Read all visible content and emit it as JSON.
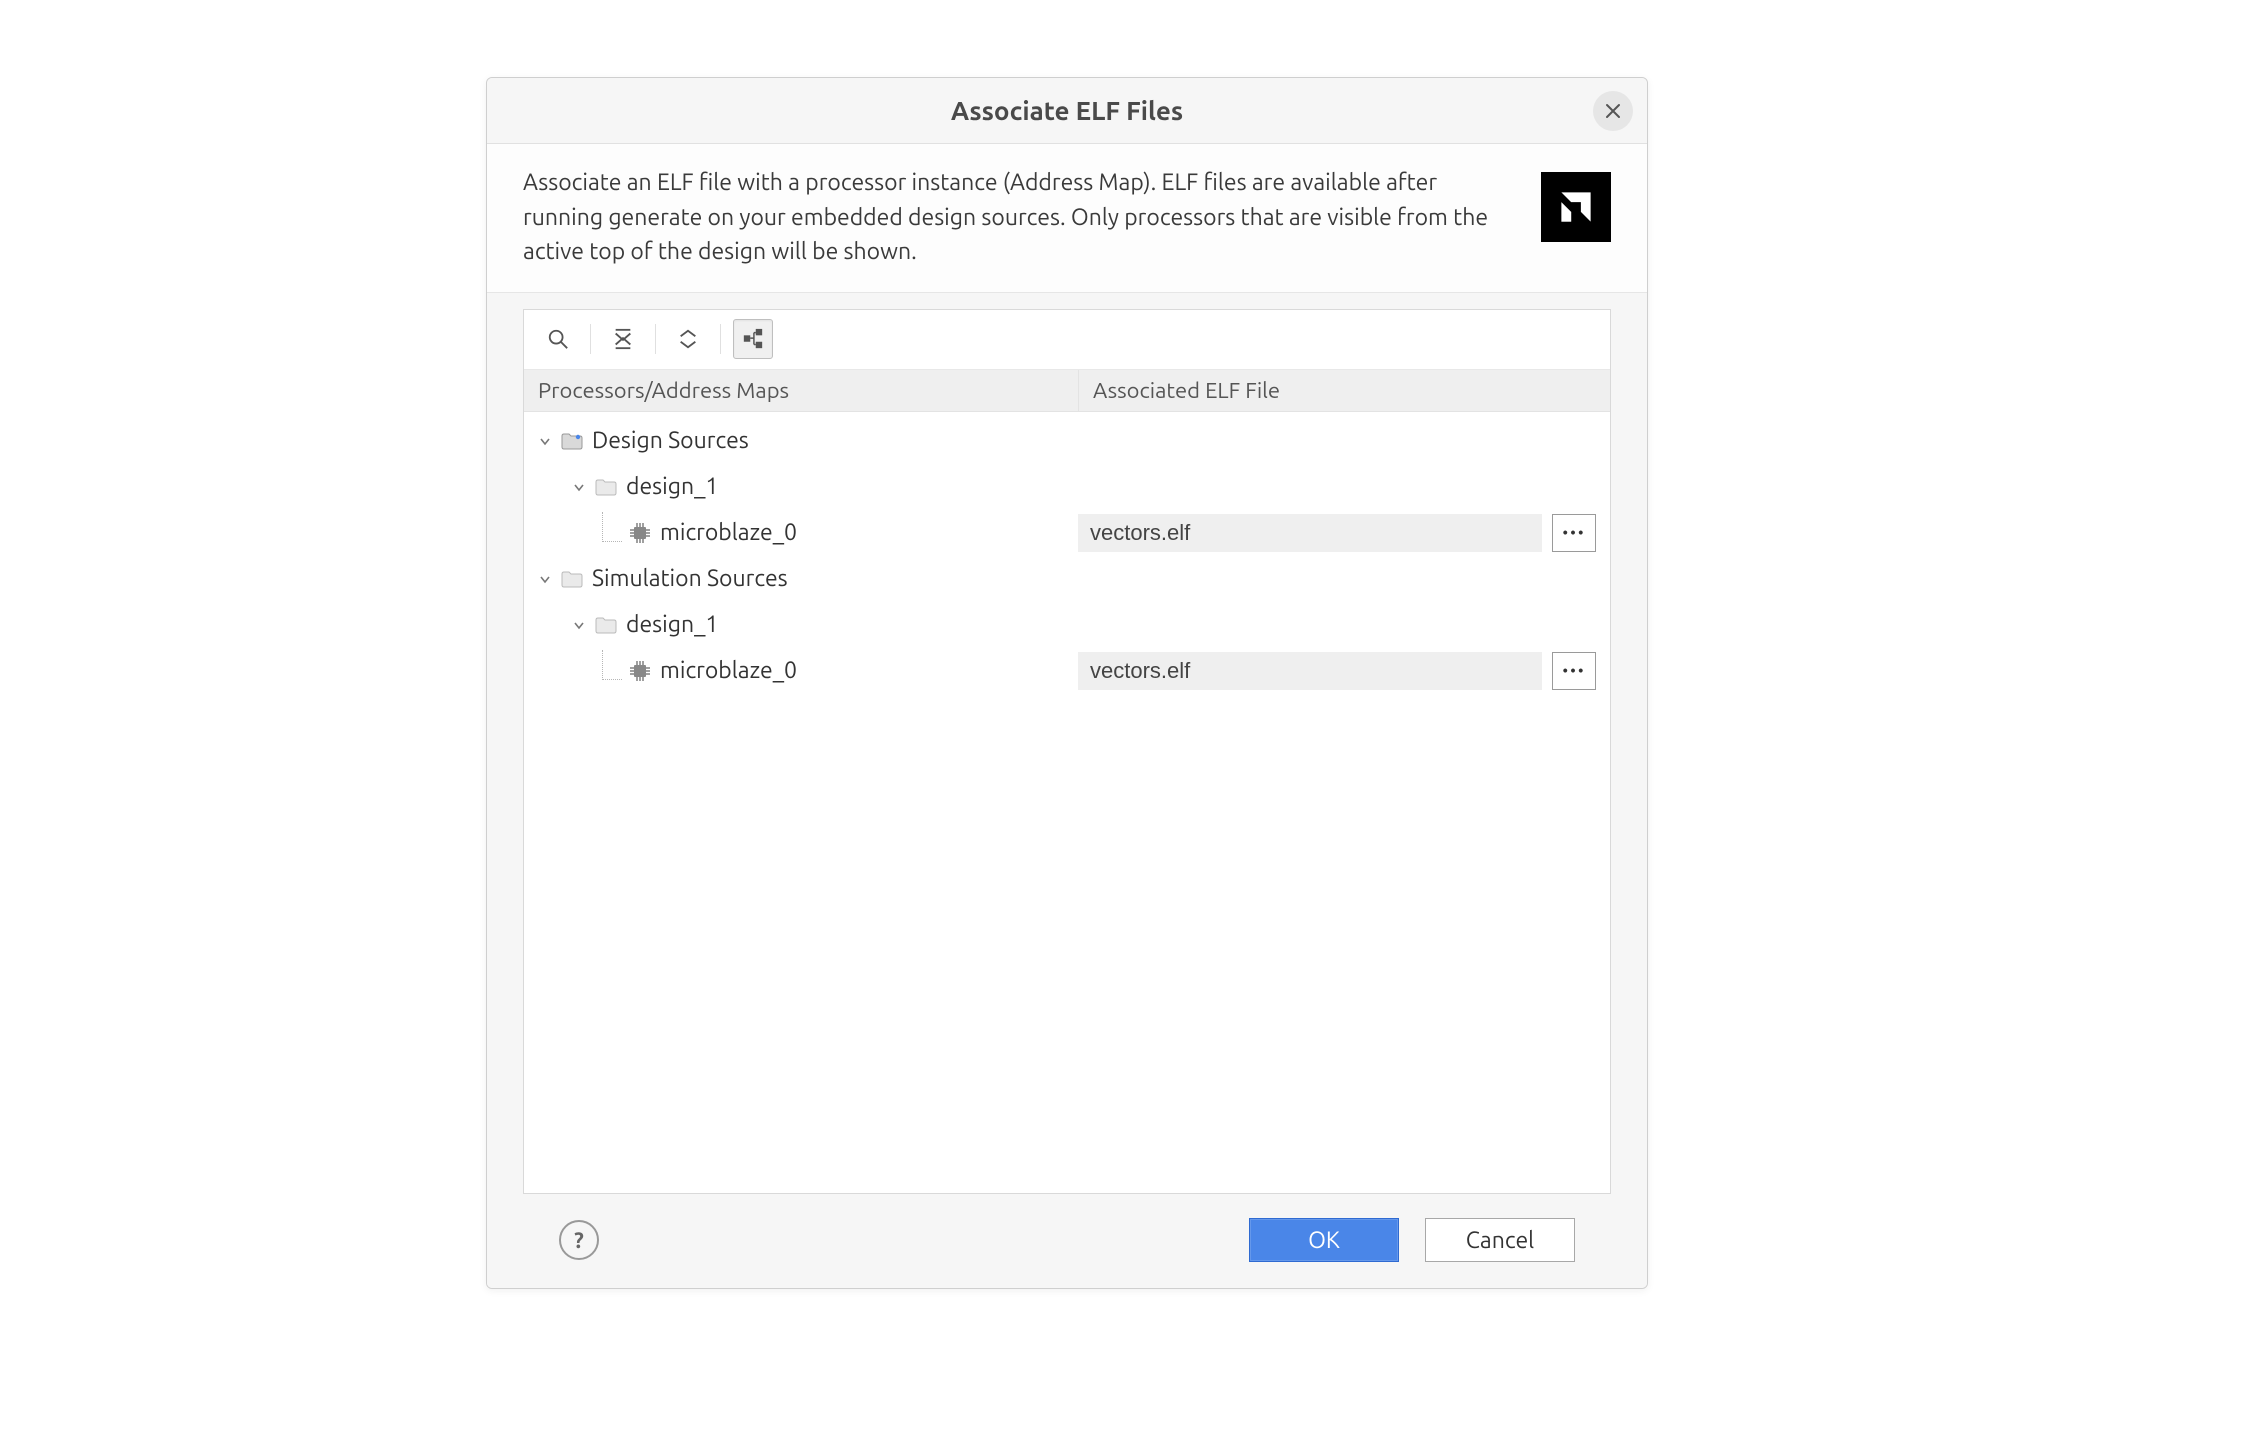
{
  "dialog": {
    "title": "Associate ELF Files",
    "description": "Associate an ELF file with a processor instance (Address Map). ELF files are available after running generate on your embedded design sources. Only processors that are visible from the active top of the design will be shown."
  },
  "columns": {
    "col1": "Processors/Address Maps",
    "col2": "Associated ELF File"
  },
  "tree": {
    "design_root": "Design Sources",
    "design_child": "design_1",
    "design_proc": "microblaze_0",
    "design_elf": "vectors.elf",
    "sim_root": "Simulation Sources",
    "sim_child": "design_1",
    "sim_proc": "microblaze_0",
    "sim_elf": "vectors.elf"
  },
  "footer": {
    "ok": "OK",
    "cancel": "Cancel"
  }
}
